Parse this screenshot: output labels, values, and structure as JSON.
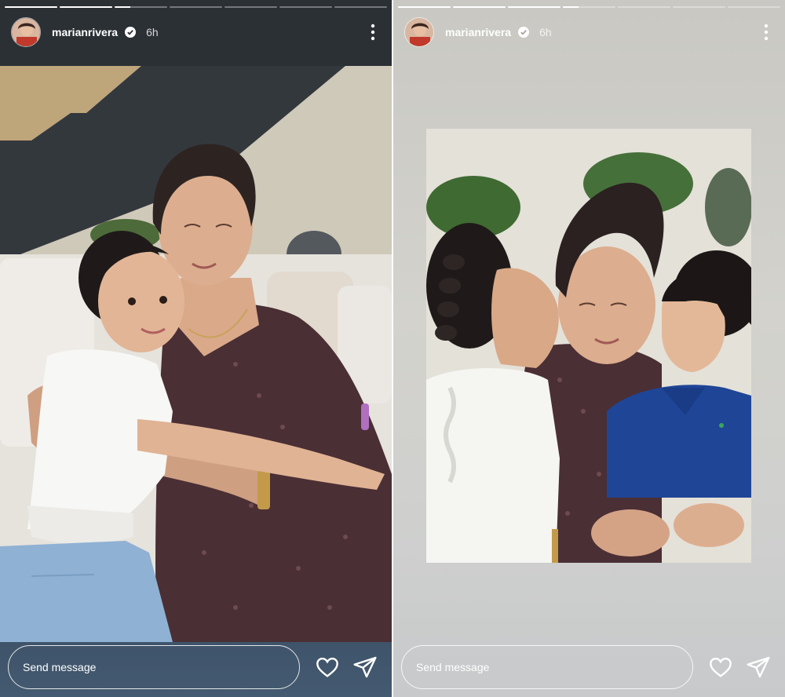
{
  "stories": [
    {
      "username": "marianrivera",
      "time": "6h",
      "verified_icon": "verified-badge-icon",
      "progress_segments": [
        1,
        1,
        0.3,
        0,
        0,
        0,
        0
      ],
      "composer": {
        "placeholder": "Send message"
      },
      "icons": {
        "more": "more-vertical-icon",
        "like": "heart-icon",
        "share": "send-icon"
      }
    },
    {
      "username": "marianrivera",
      "time": "6h",
      "verified_icon": "verified-badge-icon",
      "progress_segments": [
        1,
        1,
        1,
        0.3,
        0,
        0,
        0
      ],
      "composer": {
        "placeholder": "Send message"
      },
      "icons": {
        "more": "more-vertical-icon",
        "like": "heart-icon",
        "share": "send-icon"
      }
    }
  ],
  "colors": {
    "left_bg": "#2e3236",
    "right_bg": "#cfcfca",
    "footer_left": "#425870"
  }
}
